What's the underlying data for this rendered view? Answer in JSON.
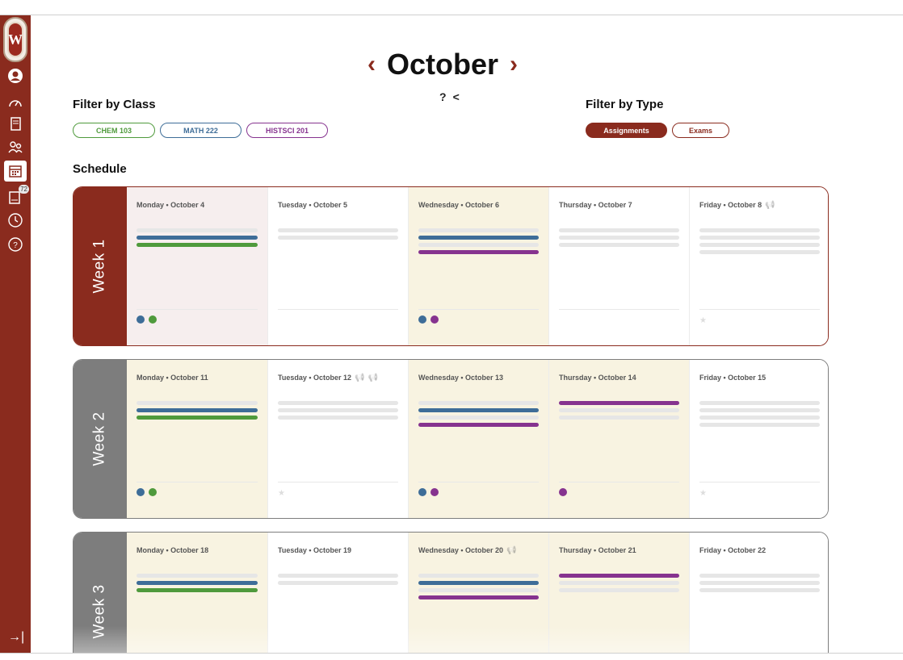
{
  "colors": {
    "brand": "#8a2b1e",
    "chem": "#4f9a3c",
    "math": "#3e6d98",
    "histsci": "#86338f",
    "grey_week": "#7d7d7d",
    "highlight": "#f8f3e1",
    "pink": "#f6eeee",
    "placeholder": "#e6e6e6"
  },
  "sidebar": {
    "logo_letter": "W",
    "icons": [
      "avatar-icon",
      "dashboard-icon",
      "book-icon",
      "people-icon",
      "calendar-icon",
      "inbox-icon",
      "clock-icon",
      "help-icon"
    ],
    "inbox_badge": "72",
    "collapse_icon": "→|"
  },
  "header": {
    "month": "October",
    "prev": "‹",
    "next": "›",
    "help": "?",
    "share": "<"
  },
  "filters": {
    "class_title": "Filter by Class",
    "classes": [
      {
        "label": "CHEM 103",
        "color": "#4f9a3c"
      },
      {
        "label": "MATH 222",
        "color": "#3e6d98"
      },
      {
        "label": "HISTSCI 201",
        "color": "#86338f"
      }
    ],
    "type_title": "Filter by Type",
    "types": [
      {
        "label": "Assignments",
        "selected": true
      },
      {
        "label": "Exams",
        "selected": false
      }
    ]
  },
  "schedule": {
    "title": "Schedule",
    "weeks": [
      {
        "label": "Week 1",
        "current": true,
        "days": [
          {
            "head": "Monday • October 4",
            "bg": "pink",
            "bars": [
              "grey",
              "math",
              "chem"
            ],
            "dots": [
              "math",
              "chem"
            ],
            "megaphones": 0
          },
          {
            "head": "Tuesday • October 5",
            "bg": "white",
            "bars": [
              "grey",
              "grey"
            ],
            "dots": [],
            "megaphones": 0
          },
          {
            "head": "Wednesday • October 6",
            "bg": "highlight",
            "bars": [
              "grey",
              "math",
              "grey",
              "histsci"
            ],
            "dots": [
              "math",
              "histsci"
            ],
            "megaphones": 0
          },
          {
            "head": "Thursday • October 7",
            "bg": "white",
            "bars": [
              "grey",
              "grey",
              "grey"
            ],
            "dots": [],
            "megaphones": 0
          },
          {
            "head": "Friday • October 8",
            "bg": "white",
            "bars": [
              "grey",
              "grey",
              "grey",
              "grey"
            ],
            "dots": [],
            "megaphones": 1,
            "star": true
          }
        ]
      },
      {
        "label": "Week 2",
        "current": false,
        "days": [
          {
            "head": "Monday • October 11",
            "bg": "highlight",
            "bars": [
              "grey",
              "math",
              "chem"
            ],
            "dots": [
              "math",
              "chem"
            ],
            "megaphones": 0
          },
          {
            "head": "Tuesday • October 12",
            "bg": "white",
            "bars": [
              "grey",
              "grey",
              "grey"
            ],
            "dots": [],
            "megaphones": 2,
            "star": true
          },
          {
            "head": "Wednesday • October 13",
            "bg": "highlight",
            "bars": [
              "grey",
              "math",
              "grey",
              "histsci"
            ],
            "dots": [
              "math",
              "histsci"
            ],
            "megaphones": 0
          },
          {
            "head": "Thursday • October 14",
            "bg": "highlight",
            "bars": [
              "histsci",
              "grey",
              "grey"
            ],
            "dots": [
              "histsci"
            ],
            "megaphones": 0
          },
          {
            "head": "Friday • October 15",
            "bg": "white",
            "bars": [
              "grey",
              "grey",
              "grey",
              "grey"
            ],
            "dots": [],
            "megaphones": 0,
            "star": true
          }
        ]
      },
      {
        "label": "Week 3",
        "current": false,
        "days": [
          {
            "head": "Monday • October 18",
            "bg": "highlight",
            "bars": [
              "grey",
              "math",
              "chem"
            ],
            "dots": [],
            "megaphones": 0
          },
          {
            "head": "Tuesday • October 19",
            "bg": "white",
            "bars": [
              "grey",
              "grey"
            ],
            "dots": [],
            "megaphones": 0
          },
          {
            "head": "Wednesday • October 20",
            "bg": "highlight",
            "bars": [
              "grey",
              "math",
              "grey",
              "histsci"
            ],
            "dots": [],
            "megaphones": 1
          },
          {
            "head": "Thursday • October 21",
            "bg": "highlight",
            "bars": [
              "histsci",
              "grey",
              "grey"
            ],
            "dots": [],
            "megaphones": 0
          },
          {
            "head": "Friday • October 22",
            "bg": "white",
            "bars": [
              "grey",
              "grey",
              "grey"
            ],
            "dots": [],
            "megaphones": 0
          }
        ]
      }
    ]
  }
}
